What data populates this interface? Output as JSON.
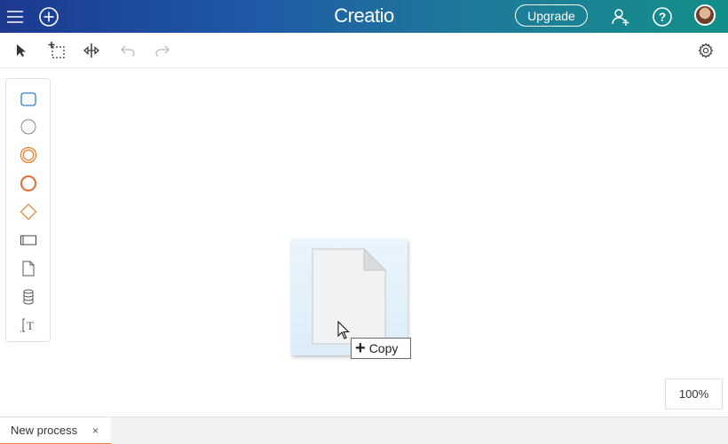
{
  "header": {
    "brand": "Creatio",
    "upgrade_label": "Upgrade",
    "icons": [
      "menu-icon",
      "add-icon",
      "add-user-icon",
      "help-icon",
      "avatar"
    ]
  },
  "toolbar": {
    "tools": [
      "select-pointer-icon",
      "lasso-select-icon",
      "space-tool-icon",
      "undo-icon",
      "redo-icon"
    ],
    "settings_icon": "gear-icon"
  },
  "palette": {
    "items": [
      "task-icon",
      "start-event-icon",
      "intermediate-event-icon",
      "end-event-icon",
      "gateway-icon",
      "lane-icon",
      "data-object-icon",
      "data-store-icon",
      "text-annotation-icon"
    ]
  },
  "drag": {
    "copy_label": "Copy"
  },
  "zoom": {
    "level": "100%"
  },
  "tabs": [
    {
      "label": "New process",
      "close": "×"
    }
  ],
  "colors": {
    "accent": "#f27a3e",
    "palette_blue": "#2d7fc7",
    "palette_orange": "#e8802f",
    "header_left": "#1c3a8f",
    "header_right": "#138f8a"
  }
}
